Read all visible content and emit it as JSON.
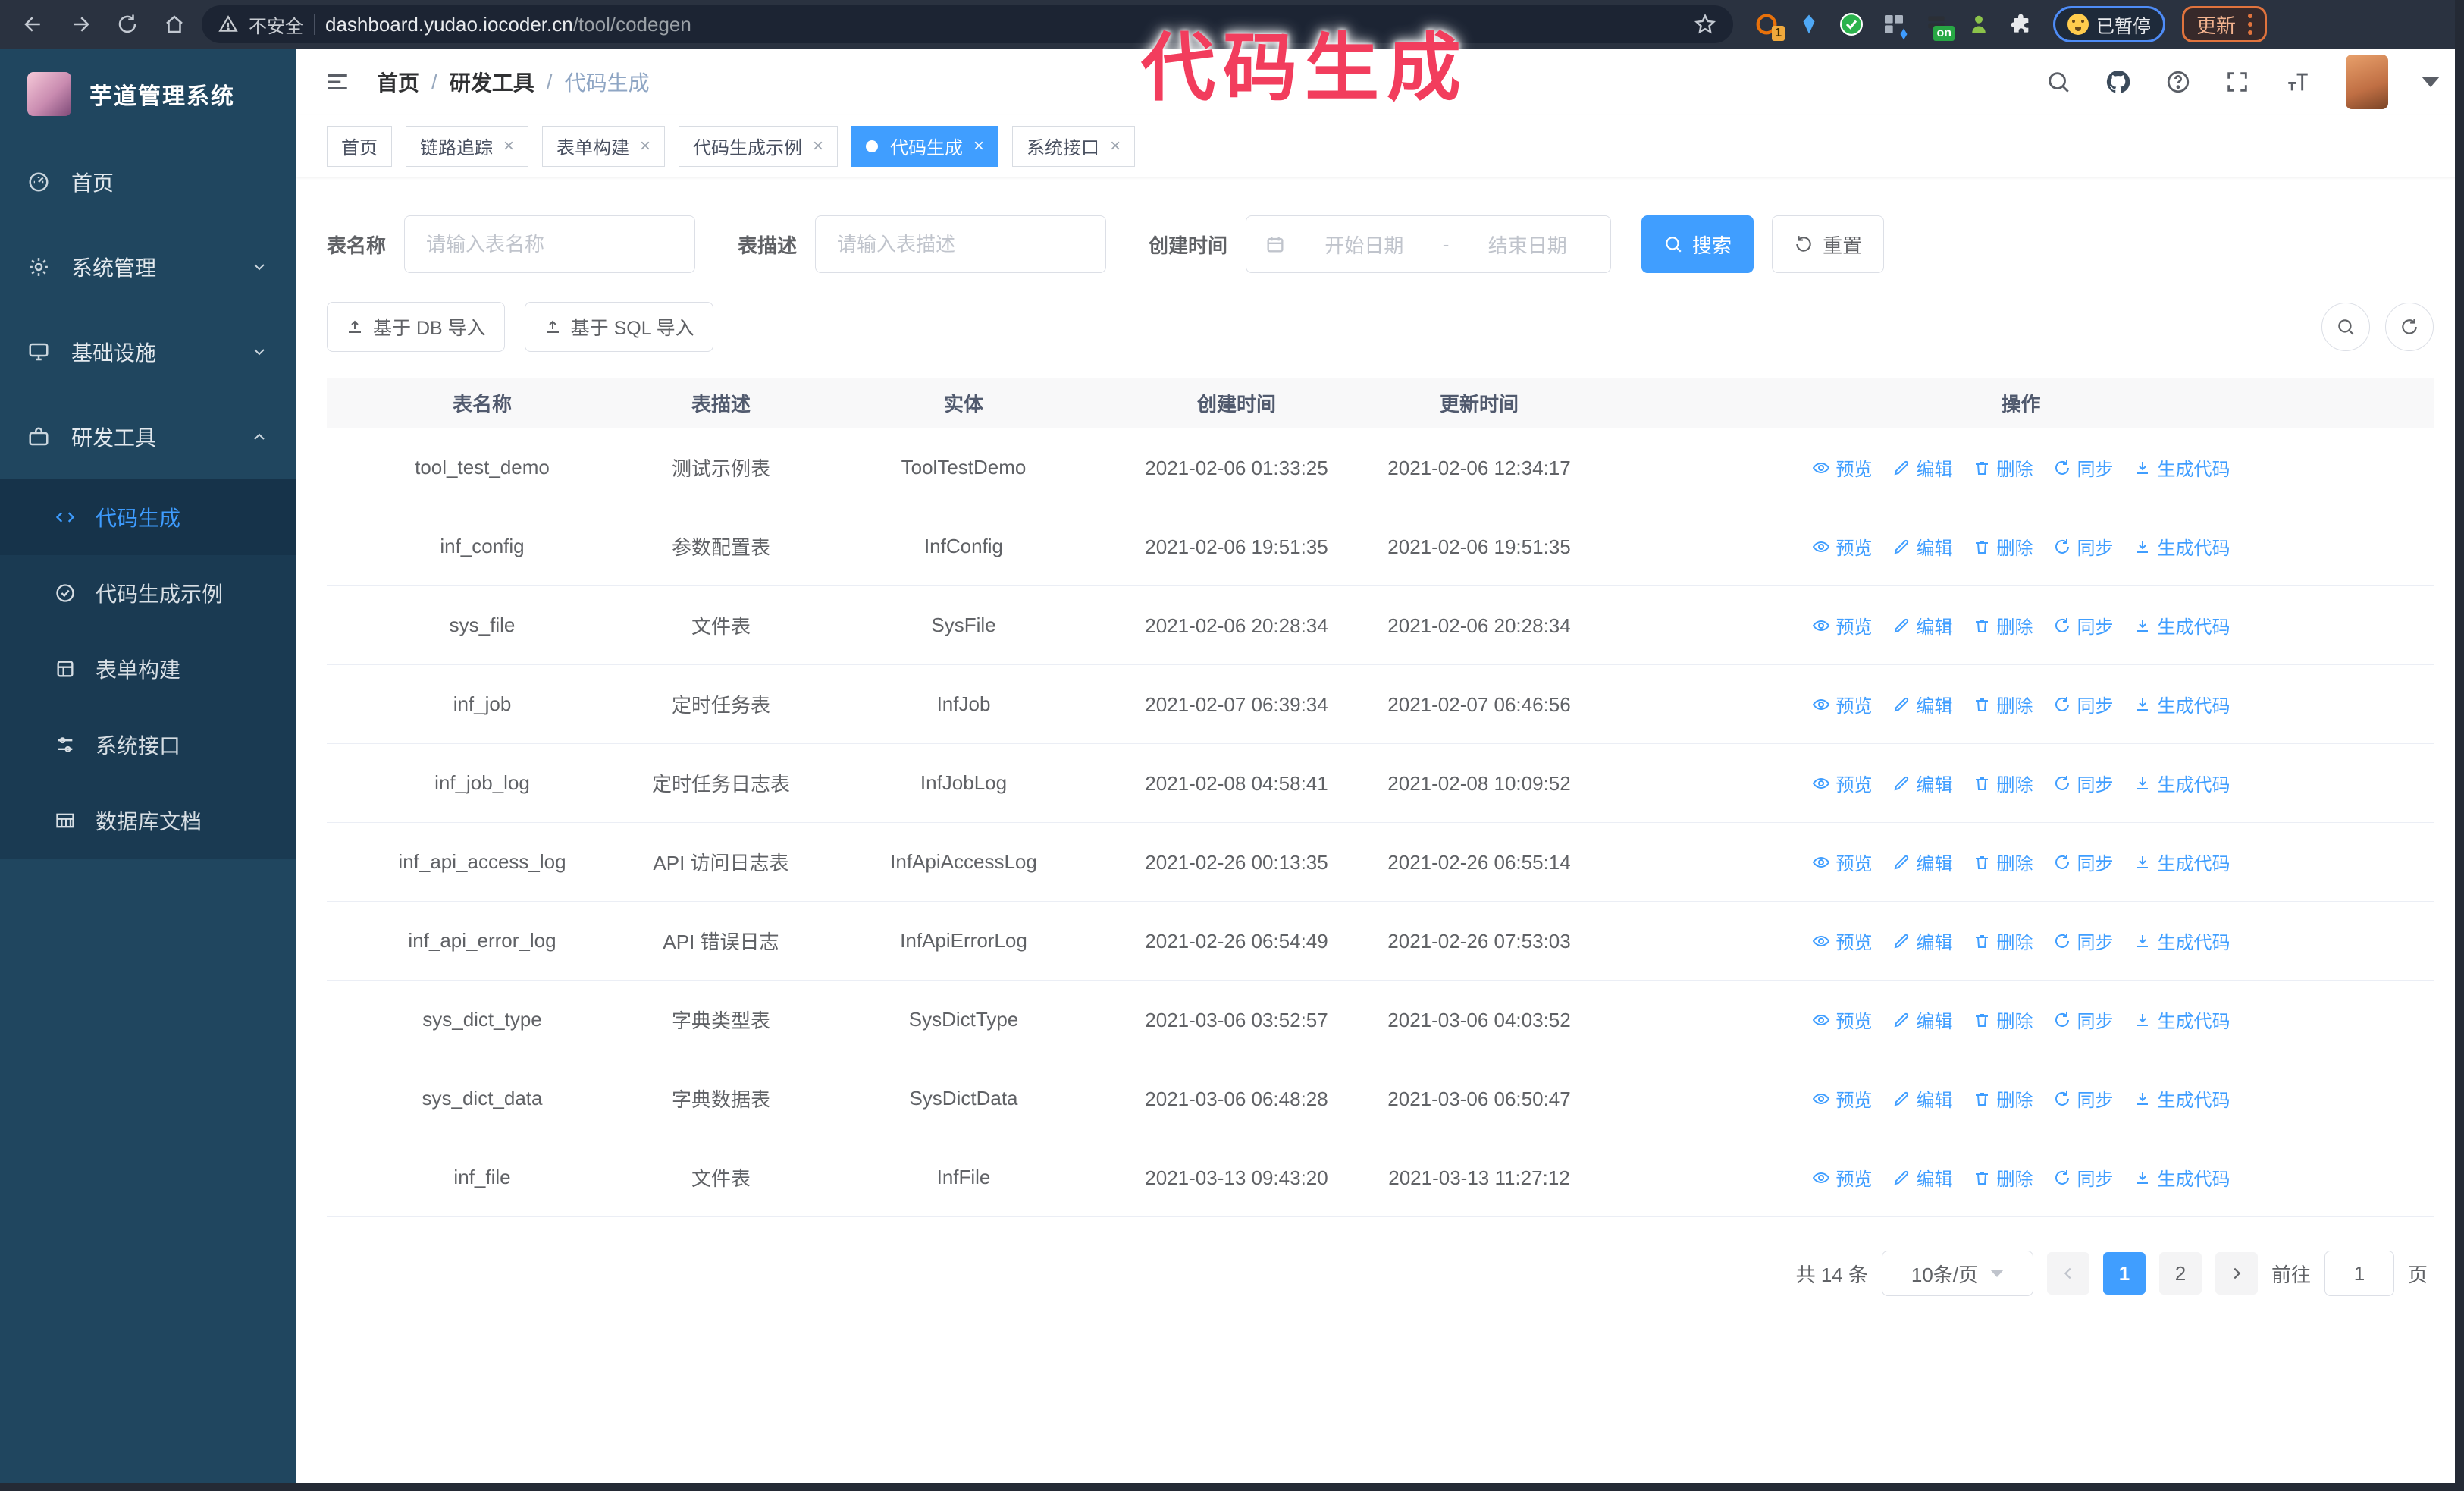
{
  "colors": {
    "accent": "#409EFF",
    "annotation": "#F23D5D",
    "sidebar_bg": "#20465F",
    "submenu_bg": "#1A3A52",
    "chrome_bg": "#2A3240"
  },
  "browser": {
    "security_warning": "不安全",
    "url_host": "dashboard.yudao.iocoder.cn",
    "url_path": "/tool/codegen",
    "extension_badge_count": "1",
    "extension_badge_on": "on",
    "paused_badge": "已暂停",
    "update_button": "更新"
  },
  "annotation": {
    "text": "代码生成"
  },
  "sidebar": {
    "app_title": "芋道管理系统",
    "items": [
      {
        "label": "首页"
      },
      {
        "label": "系统管理"
      },
      {
        "label": "基础设施"
      },
      {
        "label": "研发工具"
      }
    ],
    "submenu": [
      {
        "label": "代码生成"
      },
      {
        "label": "代码生成示例"
      },
      {
        "label": "表单构建"
      },
      {
        "label": "系统接口"
      },
      {
        "label": "数据库文档"
      }
    ]
  },
  "header": {
    "breadcrumb": [
      "首页",
      "研发工具",
      "代码生成"
    ],
    "separator": "/"
  },
  "tabs": [
    {
      "label": "首页"
    },
    {
      "label": "链路追踪"
    },
    {
      "label": "表单构建"
    },
    {
      "label": "代码生成示例"
    },
    {
      "label": "代码生成"
    },
    {
      "label": "系统接口"
    }
  ],
  "search": {
    "name_label": "表名称",
    "name_placeholder": "请输入表名称",
    "desc_label": "表描述",
    "desc_placeholder": "请输入表描述",
    "time_label": "创建时间",
    "start_placeholder": "开始日期",
    "range_separator": "-",
    "end_placeholder": "结束日期",
    "search_button": "搜索",
    "reset_button": "重置"
  },
  "toolbar": {
    "import_db_button": "基于 DB 导入",
    "import_sql_button": "基于 SQL 导入"
  },
  "table": {
    "columns": [
      "表名称",
      "表描述",
      "实体",
      "创建时间",
      "更新时间",
      "操作"
    ],
    "actions": [
      "预览",
      "编辑",
      "删除",
      "同步",
      "生成代码"
    ],
    "action_icons": [
      "eye-icon",
      "pencil-icon",
      "trash-icon",
      "sync-icon",
      "download-icon"
    ],
    "rows": [
      {
        "name": "tool_test_demo",
        "desc": "测试示例表",
        "entity": "ToolTestDemo",
        "created": "2021-02-06 01:33:25",
        "updated": "2021-02-06 12:34:17"
      },
      {
        "name": "inf_config",
        "desc": "参数配置表",
        "entity": "InfConfig",
        "created": "2021-02-06 19:51:35",
        "updated": "2021-02-06 19:51:35"
      },
      {
        "name": "sys_file",
        "desc": "文件表",
        "entity": "SysFile",
        "created": "2021-02-06 20:28:34",
        "updated": "2021-02-06 20:28:34"
      },
      {
        "name": "inf_job",
        "desc": "定时任务表",
        "entity": "InfJob",
        "created": "2021-02-07 06:39:34",
        "updated": "2021-02-07 06:46:56"
      },
      {
        "name": "inf_job_log",
        "desc": "定时任务日志表",
        "entity": "InfJobLog",
        "created": "2021-02-08 04:58:41",
        "updated": "2021-02-08 10:09:52"
      },
      {
        "name": "inf_api_access_log",
        "desc": "API 访问日志表",
        "entity": "InfApiAccessLog",
        "created": "2021-02-26 00:13:35",
        "updated": "2021-02-26 06:55:14"
      },
      {
        "name": "inf_api_error_log",
        "desc": "API 错误日志",
        "entity": "InfApiErrorLog",
        "created": "2021-02-26 06:54:49",
        "updated": "2021-02-26 07:53:03"
      },
      {
        "name": "sys_dict_type",
        "desc": "字典类型表",
        "entity": "SysDictType",
        "created": "2021-03-06 03:52:57",
        "updated": "2021-03-06 04:03:52"
      },
      {
        "name": "sys_dict_data",
        "desc": "字典数据表",
        "entity": "SysDictData",
        "created": "2021-03-06 06:48:28",
        "updated": "2021-03-06 06:50:47"
      },
      {
        "name": "inf_file",
        "desc": "文件表",
        "entity": "InfFile",
        "created": "2021-03-13 09:43:20",
        "updated": "2021-03-13 11:27:12"
      }
    ]
  },
  "pagination": {
    "total": "共 14 条",
    "page_size": "10条/页",
    "page_1": "1",
    "page_2": "2",
    "goto_label": "前往",
    "goto_value": "1",
    "page_suffix": "页"
  }
}
